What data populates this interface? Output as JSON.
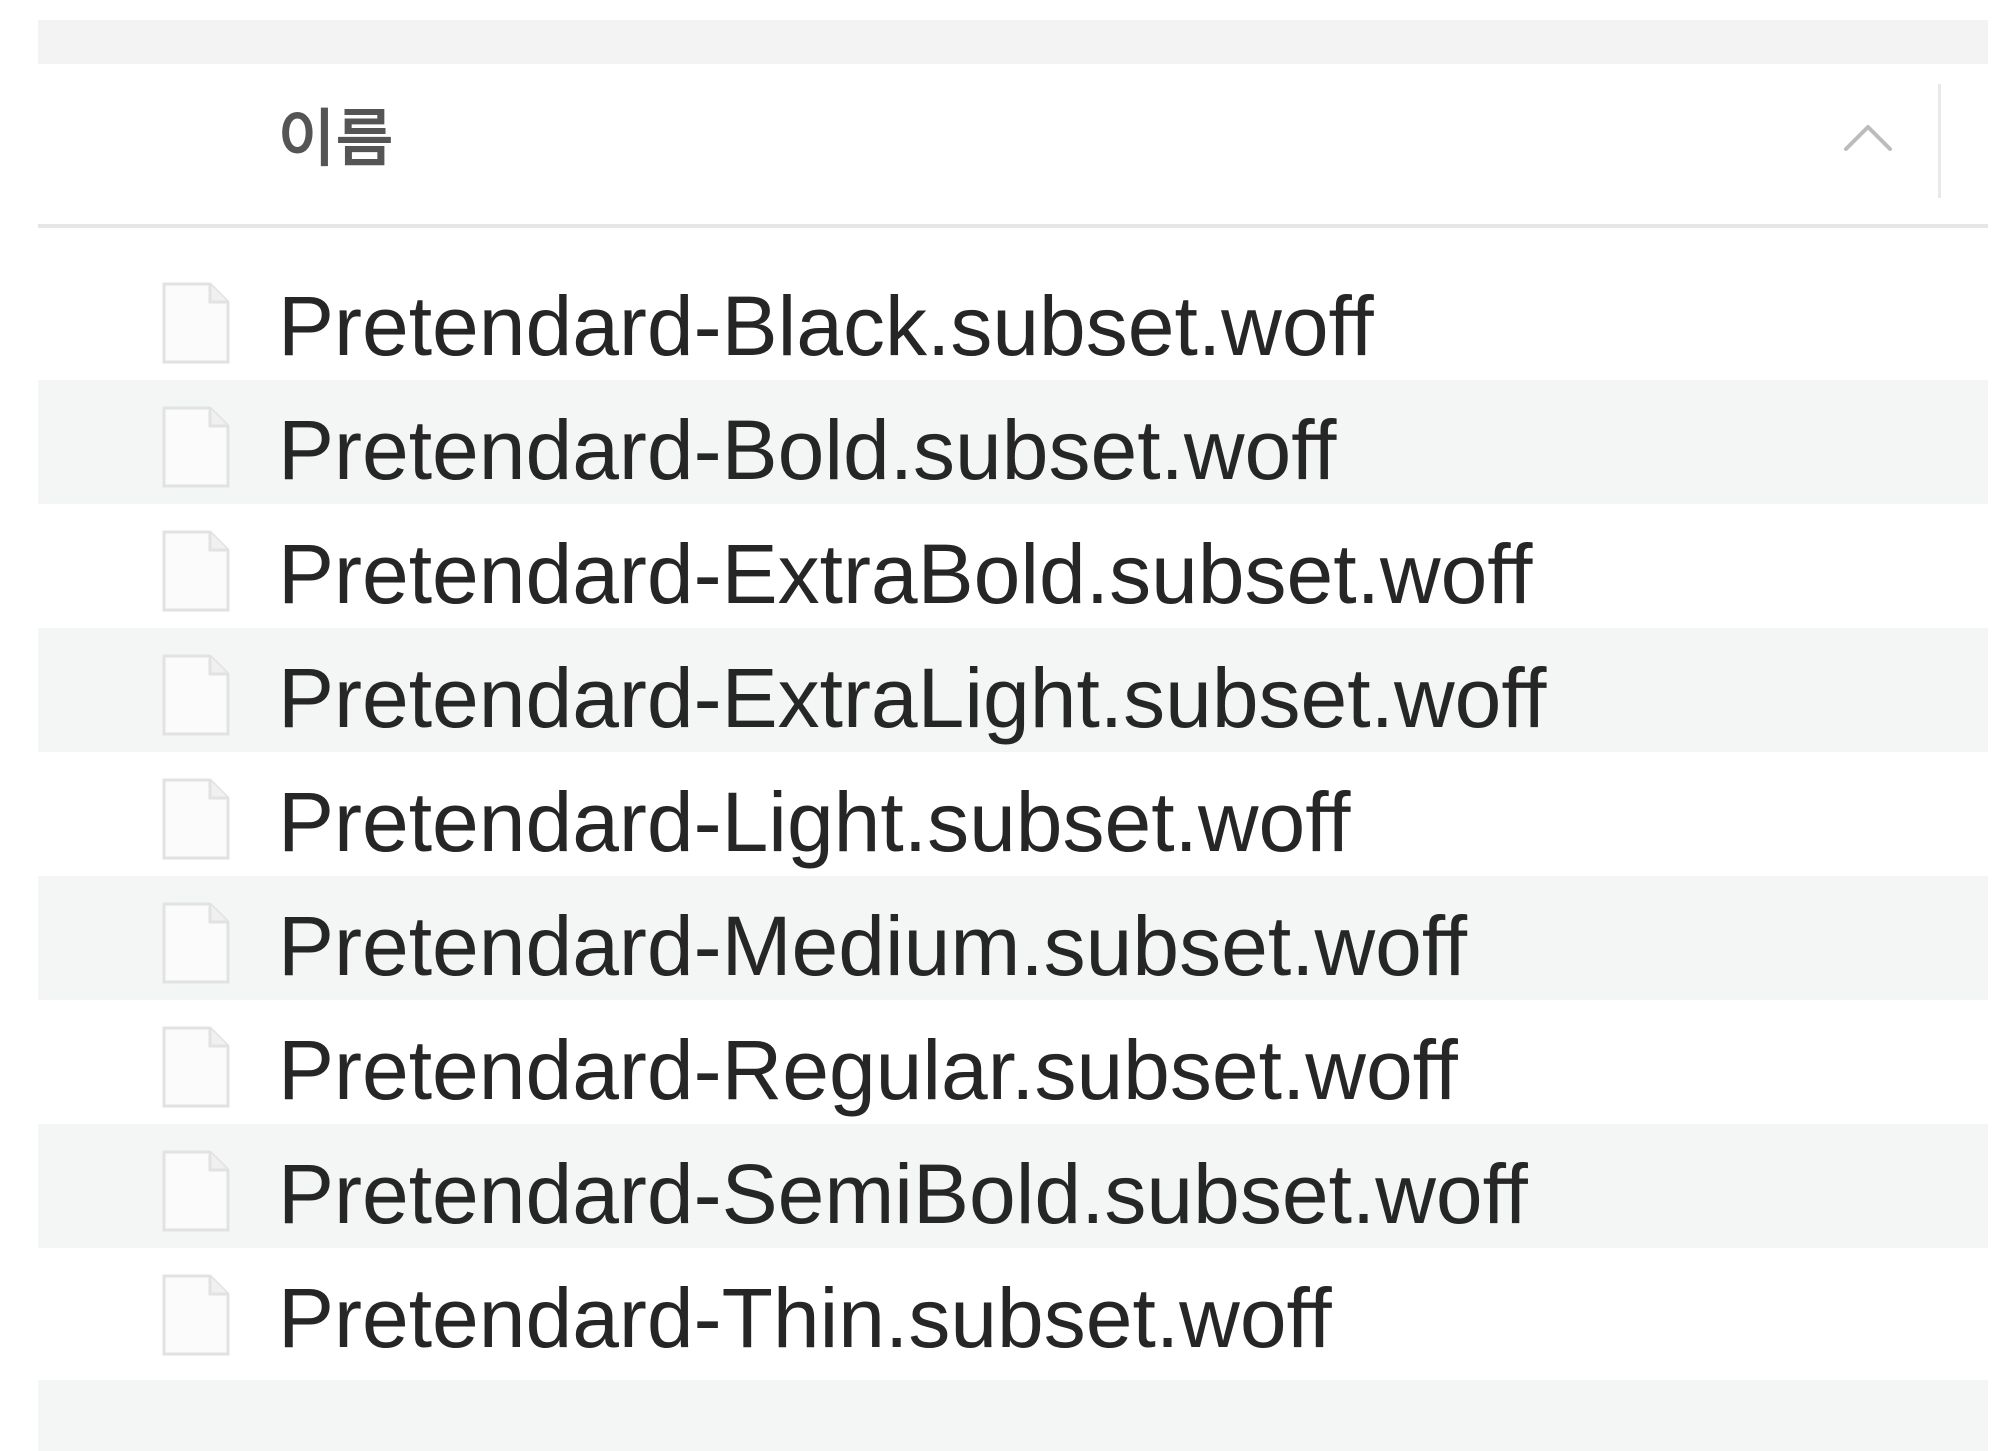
{
  "header": {
    "name_column_label": "이름",
    "sort_direction": "ascending",
    "sort_icon": "chevron-up-icon"
  },
  "files": [
    {
      "name": "Pretendard-Black.subset.woff",
      "icon": "document-icon"
    },
    {
      "name": "Pretendard-Bold.subset.woff",
      "icon": "document-icon"
    },
    {
      "name": "Pretendard-ExtraBold.subset.woff",
      "icon": "document-icon"
    },
    {
      "name": "Pretendard-ExtraLight.subset.woff",
      "icon": "document-icon"
    },
    {
      "name": "Pretendard-Light.subset.woff",
      "icon": "document-icon"
    },
    {
      "name": "Pretendard-Medium.subset.woff",
      "icon": "document-icon"
    },
    {
      "name": "Pretendard-Regular.subset.woff",
      "icon": "document-icon"
    },
    {
      "name": "Pretendard-SemiBold.subset.woff",
      "icon": "document-icon"
    },
    {
      "name": "Pretendard-Thin.subset.woff",
      "icon": "document-icon"
    }
  ],
  "colors": {
    "stripe": "#f4f5f5",
    "text": "#262626",
    "header_text": "#555555"
  }
}
